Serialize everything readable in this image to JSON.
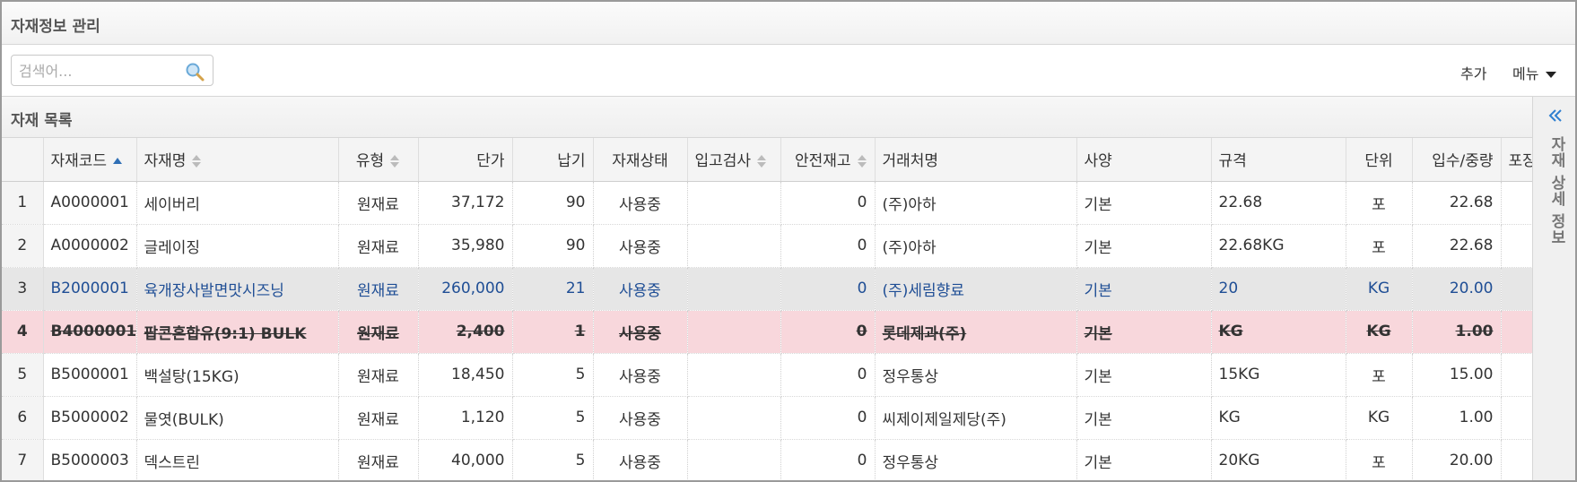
{
  "header": {
    "title": "자재정보 관리"
  },
  "toolbar": {
    "search_placeholder": "검색어...",
    "add_label": "추가",
    "menu_label": "메뉴"
  },
  "list": {
    "title": "자재 목록"
  },
  "side_panel": {
    "label": "자재 상세 정보"
  },
  "columns": [
    "자재코드",
    "자재명",
    "유형",
    "단가",
    "납기",
    "자재상태",
    "입고검사",
    "안전재고",
    "거래처명",
    "사양",
    "규격",
    "단위",
    "입수/중량",
    "포장C"
  ],
  "rows": [
    {
      "idx": "1",
      "code": "A0000001",
      "name": "세이버리",
      "type": "원재료",
      "price": "37,172",
      "lead": "90",
      "status": "사용중",
      "inspect": "",
      "safety": "0",
      "vendor": "(주)아하",
      "spec": "기본",
      "size": "22.68",
      "unit": "포",
      "weight": "22.68"
    },
    {
      "idx": "2",
      "code": "A0000002",
      "name": "글레이징",
      "type": "원재료",
      "price": "35,980",
      "lead": "90",
      "status": "사용중",
      "inspect": "",
      "safety": "0",
      "vendor": "(주)아하",
      "spec": "기본",
      "size": "22.68KG",
      "unit": "포",
      "weight": "22.68"
    },
    {
      "idx": "3",
      "code": "B2000001",
      "name": "육개장사발면맛시즈닝",
      "type": "원재료",
      "price": "260,000",
      "lead": "21",
      "status": "사용중",
      "inspect": "",
      "safety": "0",
      "vendor": "(주)세림향료",
      "spec": "기본",
      "size": "20",
      "unit": "KG",
      "weight": "20.00"
    },
    {
      "idx": "4",
      "code": "B4000001",
      "name": "팝콘혼합유(9:1) BULK",
      "type": "원재료",
      "price": "2,400",
      "lead": "1",
      "status": "사용중",
      "inspect": "",
      "safety": "0",
      "vendor": "롯데제과(주)",
      "spec": "기본",
      "size": "KG",
      "unit": "KG",
      "weight": "1.00"
    },
    {
      "idx": "5",
      "code": "B5000001",
      "name": "백설탕(15KG)",
      "type": "원재료",
      "price": "18,450",
      "lead": "5",
      "status": "사용중",
      "inspect": "",
      "safety": "0",
      "vendor": "정우통상",
      "spec": "기본",
      "size": "15KG",
      "unit": "포",
      "weight": "15.00"
    },
    {
      "idx": "6",
      "code": "B5000002",
      "name": "물엿(BULK)",
      "type": "원재료",
      "price": "1,120",
      "lead": "5",
      "status": "사용중",
      "inspect": "",
      "safety": "0",
      "vendor": "씨제이제일제당(주)",
      "spec": "기본",
      "size": "KG",
      "unit": "KG",
      "weight": "1.00"
    },
    {
      "idx": "7",
      "code": "B5000003",
      "name": "덱스트린",
      "type": "원재료",
      "price": "40,000",
      "lead": "5",
      "status": "사용중",
      "inspect": "",
      "safety": "0",
      "vendor": "정우통상",
      "spec": "기본",
      "size": "20KG",
      "unit": "포",
      "weight": "20.00"
    }
  ],
  "selected_row": "3",
  "disabled_row": "4",
  "colors": {
    "selected_text": "#1f4e95",
    "disabled_bg": "#f8d7dc",
    "selected_bg": "#e6e6e6"
  }
}
